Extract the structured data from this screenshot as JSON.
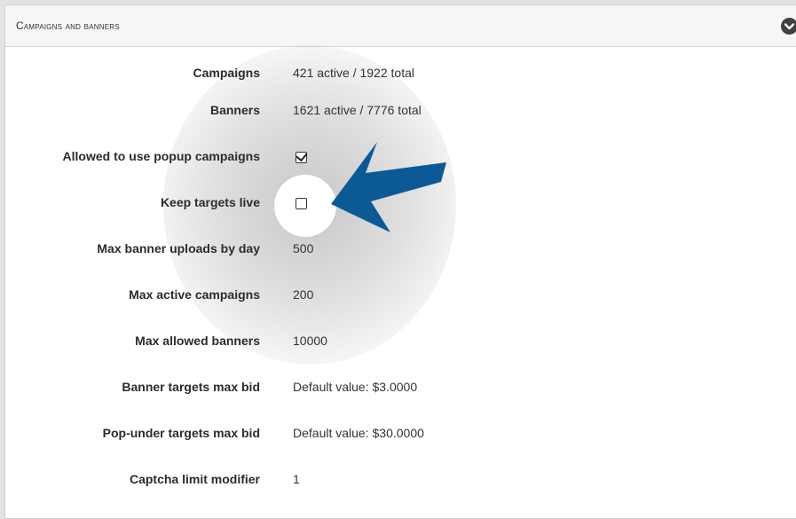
{
  "panel": {
    "title": "Campaigns and banners",
    "collapse_icon": "chevron-down-icon"
  },
  "rows": [
    {
      "label": "Campaigns",
      "value": "421 active / 1922 total"
    },
    {
      "label": "Banners",
      "value": "1621 active / 7776 total"
    },
    {
      "label": "Allowed to use popup campaigns",
      "checked": true
    },
    {
      "label": "Keep targets live",
      "checked": false
    },
    {
      "label": "Max banner uploads by day",
      "value": "500"
    },
    {
      "label": "Max active campaigns",
      "value": "200"
    },
    {
      "label": "Max allowed banners",
      "value": "10000"
    },
    {
      "label": "Banner targets max bid",
      "value": "Default value: $3.0000"
    },
    {
      "label": "Pop-under targets max bid",
      "value": "Default value: $30.0000"
    },
    {
      "label": "Captcha limit modifier",
      "value": "1"
    }
  ],
  "colors": {
    "arrow": "#0b5a96",
    "header_bg": "#f6f6f6",
    "collapse_button": "#404040"
  }
}
